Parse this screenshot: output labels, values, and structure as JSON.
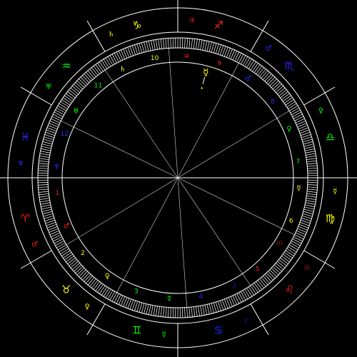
{
  "colors": {
    "background": "#000000",
    "lines": "#ffffff",
    "fire": "#ff2020",
    "earth": "#ffff00",
    "air": "#00ff00",
    "water": "#2a2aff"
  },
  "zodiac_signs": [
    {
      "name": "Aries",
      "glyph": "♈",
      "element": "fire"
    },
    {
      "name": "Taurus",
      "glyph": "♉",
      "element": "earth"
    },
    {
      "name": "Gemini",
      "glyph": "♊",
      "element": "air"
    },
    {
      "name": "Cancer",
      "glyph": "♋",
      "element": "water"
    },
    {
      "name": "Leo",
      "glyph": "♌",
      "element": "fire"
    },
    {
      "name": "Virgo",
      "glyph": "♍",
      "element": "earth"
    },
    {
      "name": "Libra",
      "glyph": "♎",
      "element": "air"
    },
    {
      "name": "Scorpio",
      "glyph": "♏",
      "element": "water"
    },
    {
      "name": "Sagittarius",
      "glyph": "♐",
      "element": "fire"
    },
    {
      "name": "Capricorn",
      "glyph": "♑",
      "element": "earth"
    },
    {
      "name": "Aquarius",
      "glyph": "♒",
      "element": "air"
    },
    {
      "name": "Pisces",
      "glyph": "♓",
      "element": "water"
    }
  ],
  "sign_rulers": [
    {
      "glyph": "♂",
      "element": "fire"
    },
    {
      "glyph": "♀",
      "element": "earth"
    },
    {
      "glyph": "☿",
      "element": "air"
    },
    {
      "glyph": "☽",
      "element": "water"
    },
    {
      "glyph": "☉",
      "element": "fire"
    },
    {
      "glyph": "☿",
      "element": "earth"
    },
    {
      "glyph": "♀",
      "element": "air"
    },
    {
      "glyph": "♂",
      "element": "water"
    },
    {
      "glyph": "♃",
      "element": "fire"
    },
    {
      "glyph": "♄",
      "element": "earth"
    },
    {
      "glyph": "♅",
      "element": "air"
    },
    {
      "glyph": "♆",
      "element": "water"
    }
  ],
  "houses": [
    {
      "number": "1",
      "sign": "Aries",
      "cusp_longitude": 0,
      "ruler": "♂",
      "element": "fire"
    },
    {
      "number": "2",
      "sign": "Taurus",
      "cusp_longitude": 31,
      "ruler": "♀",
      "element": "earth"
    },
    {
      "number": "3",
      "sign": "Gemini",
      "cusp_longitude": 62,
      "ruler": "☿",
      "element": "air"
    },
    {
      "number": "4",
      "sign": "Cancer",
      "cusp_longitude": 94,
      "ruler": "☽",
      "element": "water"
    },
    {
      "number": "5",
      "sign": "Leo",
      "cusp_longitude": 124,
      "ruler": "☉",
      "element": "fire"
    },
    {
      "number": "6",
      "sign": "Virgo",
      "cusp_longitude": 154,
      "ruler": "☿",
      "element": "earth"
    },
    {
      "number": "7",
      "sign": "Libra",
      "cusp_longitude": 180,
      "ruler": "♀",
      "element": "air"
    },
    {
      "number": "8",
      "sign": "Scorpio",
      "cusp_longitude": 211,
      "ruler": "♂",
      "element": "water"
    },
    {
      "number": "9",
      "sign": "Sagittarius",
      "cusp_longitude": 242,
      "ruler": "♃",
      "element": "fire"
    },
    {
      "number": "10",
      "sign": "Capricorn",
      "cusp_longitude": 274,
      "ruler": "♄",
      "element": "earth"
    },
    {
      "number": "11",
      "sign": "Aquarius",
      "cusp_longitude": 304,
      "ruler": "♅",
      "element": "air"
    },
    {
      "number": "12",
      "sign": "Pisces",
      "cusp_longitude": 334,
      "ruler": "♆",
      "element": "water"
    }
  ],
  "planets": [
    {
      "name": "Mercury",
      "glyph": "☿",
      "longitude": 255,
      "element": "earth",
      "with_marker": true
    }
  ]
}
